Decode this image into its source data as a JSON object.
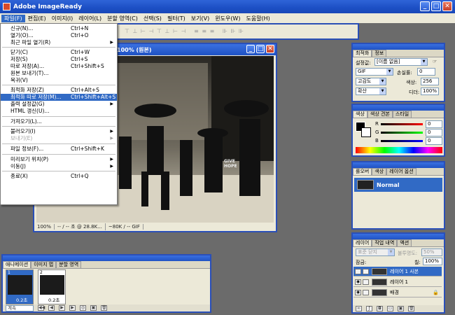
{
  "app": {
    "title": "Adobe ImageReady"
  },
  "menubar": [
    {
      "label": "파일(F)",
      "active": true
    },
    {
      "label": "편집(E)"
    },
    {
      "label": "이미지(I)"
    },
    {
      "label": "레이어(L)"
    },
    {
      "label": "분할 영역(C)"
    },
    {
      "label": "선택(S)"
    },
    {
      "label": "필터(T)"
    },
    {
      "label": "보기(V)"
    },
    {
      "label": "윈도우(W)"
    },
    {
      "label": "도움말(H)"
    }
  ],
  "file_menu": [
    {
      "label": "신규(N)...",
      "shortcut": "Ctrl+N"
    },
    {
      "label": "열기(O)...",
      "shortcut": "Ctrl+O"
    },
    {
      "label": "최근 파일 열기(R)",
      "arrow": "▶"
    },
    {
      "sep": true
    },
    {
      "label": "닫기(C)",
      "shortcut": "Ctrl+W"
    },
    {
      "label": "저장(S)",
      "shortcut": "Ctrl+S"
    },
    {
      "label": "따로 저장(A)...",
      "shortcut": "Ctrl+Shift+S"
    },
    {
      "label": "원본 보내기(T)..."
    },
    {
      "label": "복귀(V)"
    },
    {
      "sep": true
    },
    {
      "label": "최적화 저장(Z)",
      "shortcut": "Ctrl+Alt+S"
    },
    {
      "label": "최적화 따로 저장(M)...",
      "shortcut": "Ctrl+Shift+Alt+S",
      "selected": true
    },
    {
      "label": "출력 설정값(G)",
      "arrow": "▶"
    },
    {
      "label": "HTML 갱신(U)..."
    },
    {
      "sep": true
    },
    {
      "label": "가져오기(L)..."
    },
    {
      "sep": true
    },
    {
      "label": "불러오기(I)",
      "arrow": "▶"
    },
    {
      "label": "보내기(E)",
      "arrow": "▶",
      "disabled": true
    },
    {
      "sep": true
    },
    {
      "label": "파일 정보(F)...",
      "shortcut": "Ctrl+Shift+K"
    },
    {
      "sep": true
    },
    {
      "label": "미리보기 위치(P)",
      "arrow": "▶"
    },
    {
      "label": "이동(J)",
      "arrow": "▶"
    },
    {
      "sep": true
    },
    {
      "label": "종료(X)",
      "shortcut": "Ctrl+Q"
    }
  ],
  "document": {
    "title": "100% (원본)",
    "photo_text_1": "GIVE",
    "photo_text_2": "HOPE",
    "status": {
      "zoom": "100%",
      "time": "-- / -- 초 @ 28.8K...",
      "size": "~80K / -- GIF"
    }
  },
  "optimize_panel": {
    "tabs": [
      "최적화",
      "정보"
    ],
    "preset_label": "설정값:",
    "preset_value": "[이름 없음]",
    "format": "GIF",
    "lossy_label": "손실률:",
    "lossy_value": "0",
    "reduction": "고감도",
    "colors_label": "색상:",
    "colors_value": "256",
    "dither_method": "확산",
    "dither_label": "디더:",
    "dither_value": "100%"
  },
  "color_panel": {
    "tabs": [
      "색상",
      "색상 견본",
      "스타일"
    ],
    "channels": [
      {
        "label": "R",
        "value": "0"
      },
      {
        "label": "G",
        "value": "0"
      },
      {
        "label": "B",
        "value": "0"
      }
    ]
  },
  "rollover_panel": {
    "tabs": [
      "롤오버",
      "색상",
      "레이어 옵션"
    ],
    "state": "Normal"
  },
  "layers_panel": {
    "tabs": [
      "레이어",
      "작업 내역",
      "액션"
    ],
    "blend_mode": "표준 닫지",
    "opacity_label": "불투명도:",
    "opacity_value": "50%",
    "lock_label": "잠금:",
    "fill_label": "칠:",
    "fill_value": "100%",
    "layers": [
      {
        "name": "레이어 1 사본",
        "selected": true
      },
      {
        "name": "레이어 1"
      },
      {
        "name": "배경",
        "locked": true
      }
    ]
  },
  "animation_panel": {
    "tabs": [
      "애니메이션",
      "이미지 맵",
      "분할 영역"
    ],
    "frames": [
      {
        "number": "1",
        "delay": "0.2초"
      },
      {
        "number": "2",
        "delay": "0.2초"
      }
    ],
    "loop": "계속"
  },
  "colors": {
    "accent": "#316ac5",
    "titlebar": "#1c4fc4",
    "panel_bg": "#ece9d8"
  }
}
